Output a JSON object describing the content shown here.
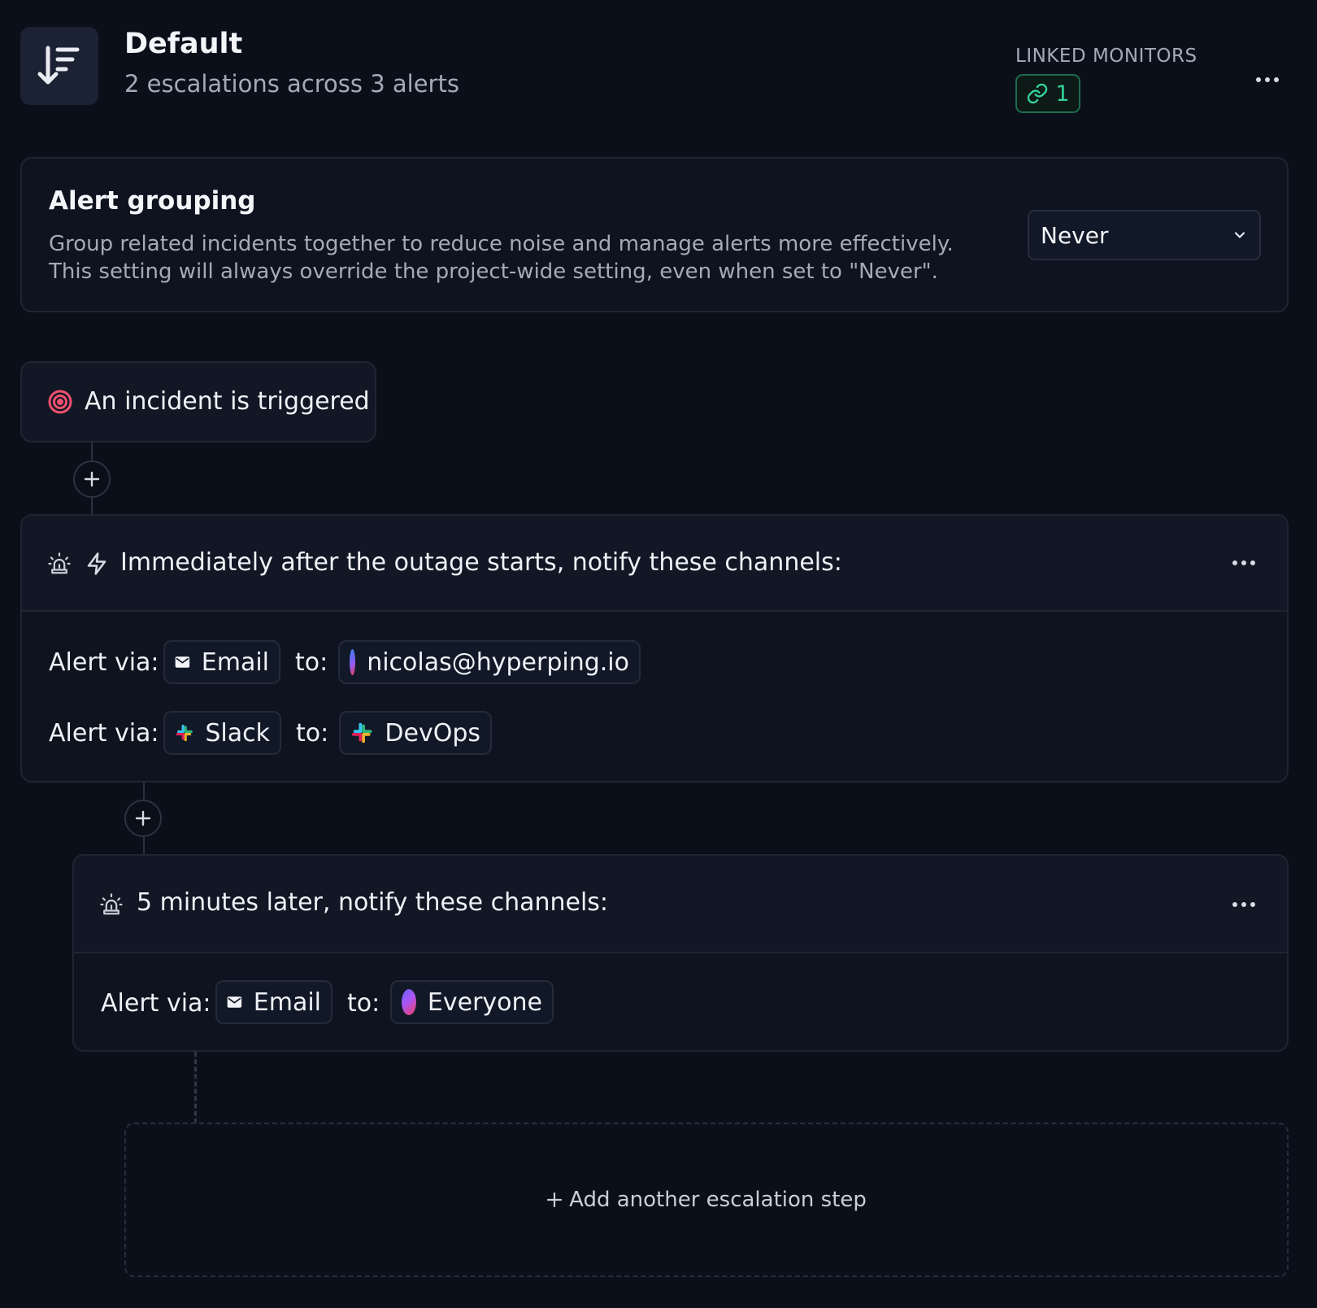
{
  "header": {
    "title": "Default",
    "subtitle": "2 escalations across 3 alerts",
    "linked_monitors_label": "LINKED MONITORS",
    "linked_monitors_count": "1",
    "icon": "sort-down-icon",
    "menu_icon": "more-horizontal-icon"
  },
  "alert_grouping": {
    "title": "Alert grouping",
    "description": "Group related incidents together to reduce noise and manage alerts more effectively. This setting will always override the project-wide setting, even when set to \"Never\".",
    "select_value": "Never"
  },
  "trigger": {
    "label": "An incident is triggered",
    "icon": "target-icon"
  },
  "escalations": [
    {
      "title": "Immediately after the outage starts, notify these channels:",
      "rows": [
        {
          "via_label": "Alert via:",
          "channel": "Email",
          "to_label": "to:",
          "target": "nicolas@hyperping.io"
        },
        {
          "via_label": "Alert via:",
          "channel": "Slack",
          "to_label": "to:",
          "target": "DevOps"
        }
      ]
    },
    {
      "title": "5 minutes later, notify these channels:",
      "rows": [
        {
          "via_label": "Alert via:",
          "channel": "Email",
          "to_label": "to:",
          "target": "Everyone"
        }
      ]
    }
  ],
  "add_step": {
    "label": "Add another escalation step"
  },
  "colors": {
    "background": "#0b0f19",
    "card": "#0e131f",
    "accent_green": "#34d399",
    "trigger_red": "#f0506e"
  }
}
